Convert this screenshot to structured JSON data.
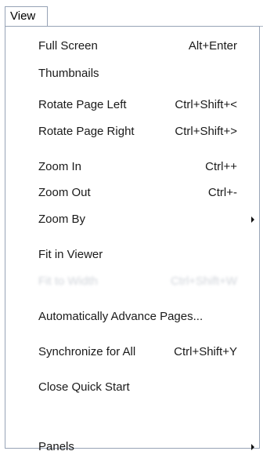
{
  "menubar": {
    "view_label": "View"
  },
  "menu": {
    "items": [
      {
        "label": "Full Screen",
        "shortcut": "Alt+Enter",
        "enabled": true
      },
      {
        "label": "Thumbnails",
        "shortcut": "",
        "enabled": true
      },
      {
        "label": "Rotate Page Left",
        "shortcut": "Ctrl+Shift+<",
        "enabled": true
      },
      {
        "label": "Rotate Page Right",
        "shortcut": "Ctrl+Shift+>",
        "enabled": true
      },
      {
        "label": "Zoom In",
        "shortcut": "Ctrl++",
        "enabled": true
      },
      {
        "label": "Zoom Out",
        "shortcut": "Ctrl+-",
        "enabled": true
      },
      {
        "label": "Zoom By",
        "shortcut": "",
        "enabled": true,
        "submenu": true
      },
      {
        "label": "Fit in Viewer",
        "shortcut": "",
        "enabled": true
      },
      {
        "label": "Fit to Width",
        "shortcut": "Ctrl+Shift+W",
        "enabled": false
      },
      {
        "label": "Automatically Advance Pages...",
        "shortcut": "",
        "enabled": true
      },
      {
        "label": "Synchronize for All",
        "shortcut": "Ctrl+Shift+Y",
        "enabled": true
      },
      {
        "label": "Close Quick Start",
        "shortcut": "",
        "enabled": true
      },
      {
        "label": "",
        "shortcut": "",
        "enabled": false
      },
      {
        "label": "Panels",
        "shortcut": "",
        "enabled": true,
        "submenu": true
      }
    ]
  }
}
